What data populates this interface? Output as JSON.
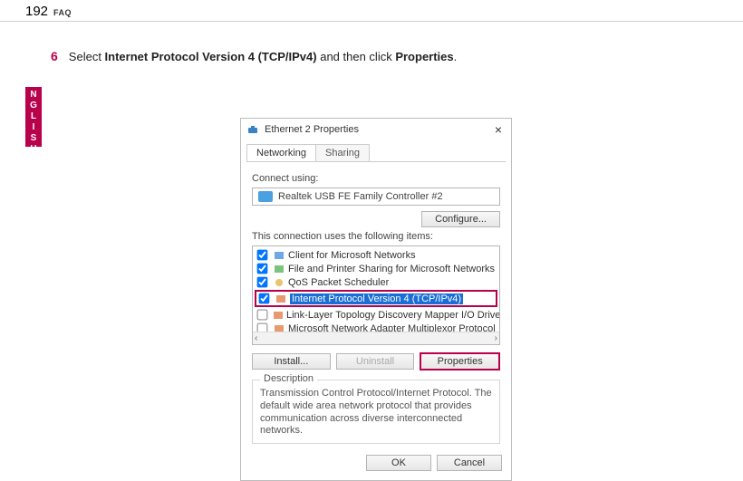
{
  "page": {
    "number": "192",
    "section": "FAQ",
    "language_tab": "ENGLISH"
  },
  "instruction": {
    "step_num": "6",
    "prefix": "Select ",
    "bold1": "Internet Protocol Version 4 (TCP/IPv4)",
    "mid": " and then click ",
    "bold2": "Properties",
    "suffix": "."
  },
  "dialog": {
    "title": "Ethernet 2 Properties",
    "close_glyph": "×",
    "tabs": {
      "networking": "Networking",
      "sharing": "Sharing"
    },
    "connect_label": "Connect using:",
    "adapter": "Realtek USB FE Family Controller #2",
    "configure_btn": "Configure...",
    "uses_label": "This connection uses the following items:",
    "items": [
      {
        "checked": true,
        "icon": "client",
        "label": "Client for Microsoft Networks"
      },
      {
        "checked": true,
        "icon": "share",
        "label": "File and Printer Sharing for Microsoft Networks"
      },
      {
        "checked": true,
        "icon": "sched",
        "label": "QoS Packet Scheduler"
      },
      {
        "checked": true,
        "icon": "proto",
        "label": "Internet Protocol Version 4 (TCP/IPv4)",
        "highlight": true
      },
      {
        "checked": false,
        "icon": "driver",
        "label": "Link-Layer Topology Discovery Mapper I/O Driver"
      },
      {
        "checked": false,
        "icon": "driver",
        "label": "Microsoft Network Adapter Multiplexor Protocol"
      }
    ],
    "scroll_left": "‹",
    "scroll_right": "›",
    "install_btn": "Install...",
    "uninstall_btn": "Uninstall",
    "properties_btn": "Properties",
    "description_label": "Description",
    "description_text": "Transmission Control Protocol/Internet Protocol. The default wide area network protocol that provides communication across diverse interconnected networks.",
    "ok_btn": "OK",
    "cancel_btn": "Cancel"
  }
}
